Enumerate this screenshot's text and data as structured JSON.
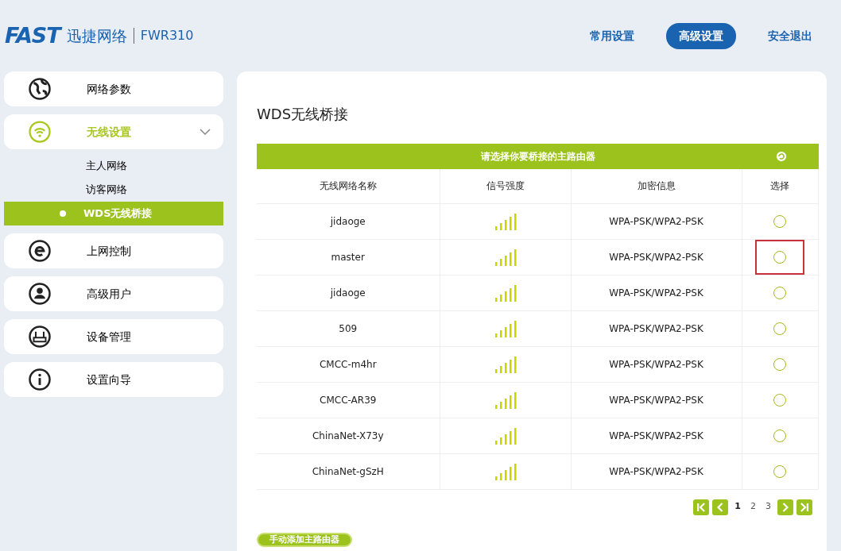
{
  "header": {
    "brand": "FAST",
    "brand_cn": "迅捷网络",
    "model": "FWR310",
    "nav": [
      {
        "label": "常用设置",
        "selected": false
      },
      {
        "label": "高级设置",
        "selected": true
      },
      {
        "label": "安全退出",
        "selected": false
      }
    ]
  },
  "sidebar": {
    "items": [
      {
        "label": "网络参数",
        "selected": false
      },
      {
        "label": "无线设置",
        "expanded": true,
        "selected": true,
        "children": [
          {
            "label": "主人网络",
            "selected": false
          },
          {
            "label": "访客网络",
            "selected": false
          },
          {
            "label": "WDS无线桥接",
            "selected": true
          }
        ]
      },
      {
        "label": "上网控制",
        "selected": false
      },
      {
        "label": "高级用户",
        "selected": false
      },
      {
        "label": "设备管理",
        "selected": false
      },
      {
        "label": "设置向导",
        "selected": false
      }
    ]
  },
  "main": {
    "title": "WDS无线桥接",
    "table_title": "请选择你要桥接的主路由器",
    "table": {
      "columns": [
        "无线网络名称",
        "信号强度",
        "加密信息",
        "选择"
      ],
      "rows": [
        {
          "name": "jidaoge",
          "security": "WPA-PSK/WPA2-PSK",
          "selected": false,
          "highlighted": false
        },
        {
          "name": "master",
          "security": "WPA-PSK/WPA2-PSK",
          "selected": false,
          "highlighted": true
        },
        {
          "name": "jidaoge",
          "security": "WPA-PSK/WPA2-PSK",
          "selected": false,
          "highlighted": false
        },
        {
          "name": "509",
          "security": "WPA-PSK/WPA2-PSK",
          "selected": false,
          "highlighted": false
        },
        {
          "name": "CMCC-m4hr",
          "security": "WPA-PSK/WPA2-PSK",
          "selected": false,
          "highlighted": false
        },
        {
          "name": "CMCC-AR39",
          "security": "WPA-PSK/WPA2-PSK",
          "selected": false,
          "highlighted": false
        },
        {
          "name": "ChinaNet-X73y",
          "security": "WPA-PSK/WPA2-PSK",
          "selected": false,
          "highlighted": false
        },
        {
          "name": "ChinaNet-gSzH",
          "security": "WPA-PSK/WPA2-PSK",
          "selected": false,
          "highlighted": false
        }
      ]
    },
    "pagination": {
      "pages": [
        {
          "label": "1",
          "selected": true
        },
        {
          "label": "2",
          "selected": false
        },
        {
          "label": "3",
          "selected": false
        }
      ]
    },
    "add_button": "手动添加主路由器"
  }
}
